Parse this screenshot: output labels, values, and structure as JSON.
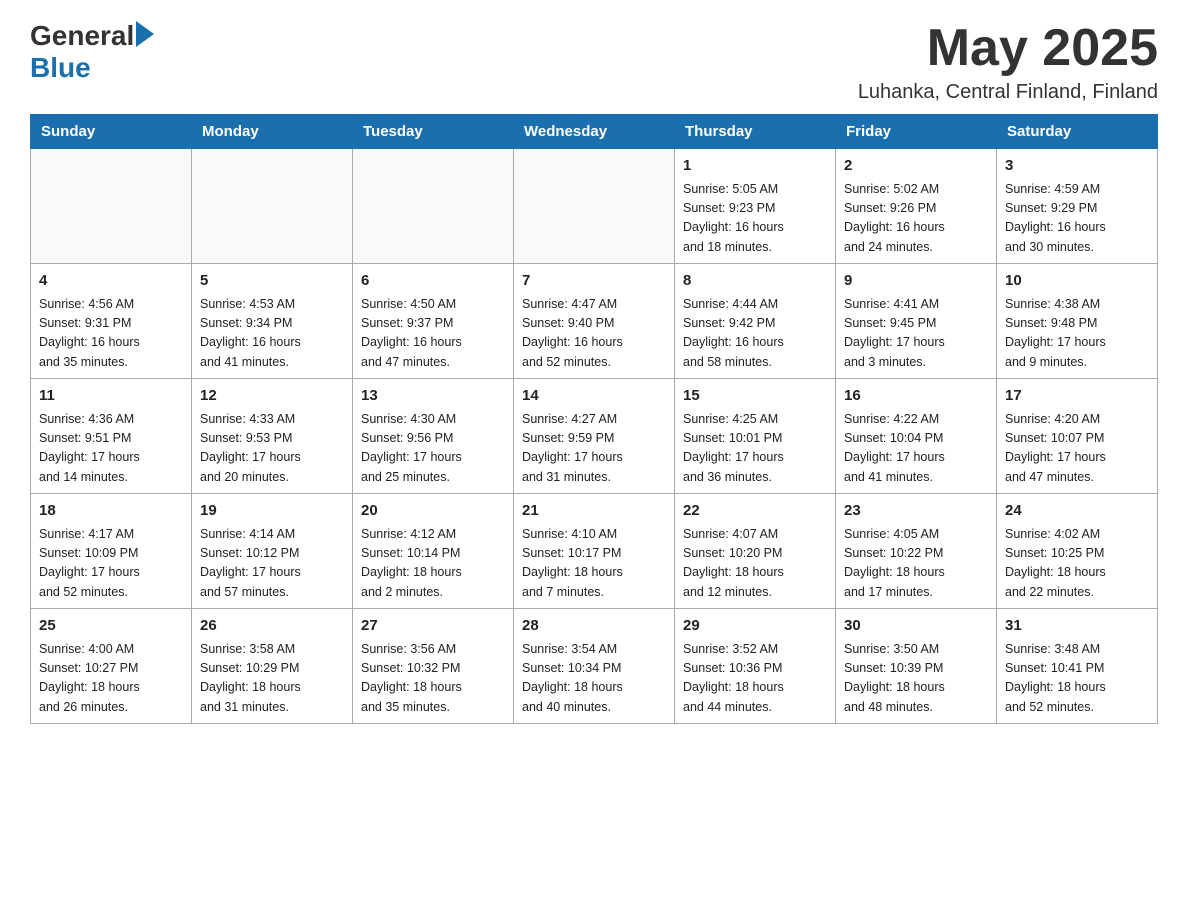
{
  "header": {
    "logo_general": "General",
    "logo_blue": "Blue",
    "month_title": "May 2025",
    "location": "Luhanka, Central Finland, Finland"
  },
  "days_of_week": [
    "Sunday",
    "Monday",
    "Tuesday",
    "Wednesday",
    "Thursday",
    "Friday",
    "Saturday"
  ],
  "weeks": [
    [
      {
        "day": "",
        "info": ""
      },
      {
        "day": "",
        "info": ""
      },
      {
        "day": "",
        "info": ""
      },
      {
        "day": "",
        "info": ""
      },
      {
        "day": "1",
        "info": "Sunrise: 5:05 AM\nSunset: 9:23 PM\nDaylight: 16 hours\nand 18 minutes."
      },
      {
        "day": "2",
        "info": "Sunrise: 5:02 AM\nSunset: 9:26 PM\nDaylight: 16 hours\nand 24 minutes."
      },
      {
        "day": "3",
        "info": "Sunrise: 4:59 AM\nSunset: 9:29 PM\nDaylight: 16 hours\nand 30 minutes."
      }
    ],
    [
      {
        "day": "4",
        "info": "Sunrise: 4:56 AM\nSunset: 9:31 PM\nDaylight: 16 hours\nand 35 minutes."
      },
      {
        "day": "5",
        "info": "Sunrise: 4:53 AM\nSunset: 9:34 PM\nDaylight: 16 hours\nand 41 minutes."
      },
      {
        "day": "6",
        "info": "Sunrise: 4:50 AM\nSunset: 9:37 PM\nDaylight: 16 hours\nand 47 minutes."
      },
      {
        "day": "7",
        "info": "Sunrise: 4:47 AM\nSunset: 9:40 PM\nDaylight: 16 hours\nand 52 minutes."
      },
      {
        "day": "8",
        "info": "Sunrise: 4:44 AM\nSunset: 9:42 PM\nDaylight: 16 hours\nand 58 minutes."
      },
      {
        "day": "9",
        "info": "Sunrise: 4:41 AM\nSunset: 9:45 PM\nDaylight: 17 hours\nand 3 minutes."
      },
      {
        "day": "10",
        "info": "Sunrise: 4:38 AM\nSunset: 9:48 PM\nDaylight: 17 hours\nand 9 minutes."
      }
    ],
    [
      {
        "day": "11",
        "info": "Sunrise: 4:36 AM\nSunset: 9:51 PM\nDaylight: 17 hours\nand 14 minutes."
      },
      {
        "day": "12",
        "info": "Sunrise: 4:33 AM\nSunset: 9:53 PM\nDaylight: 17 hours\nand 20 minutes."
      },
      {
        "day": "13",
        "info": "Sunrise: 4:30 AM\nSunset: 9:56 PM\nDaylight: 17 hours\nand 25 minutes."
      },
      {
        "day": "14",
        "info": "Sunrise: 4:27 AM\nSunset: 9:59 PM\nDaylight: 17 hours\nand 31 minutes."
      },
      {
        "day": "15",
        "info": "Sunrise: 4:25 AM\nSunset: 10:01 PM\nDaylight: 17 hours\nand 36 minutes."
      },
      {
        "day": "16",
        "info": "Sunrise: 4:22 AM\nSunset: 10:04 PM\nDaylight: 17 hours\nand 41 minutes."
      },
      {
        "day": "17",
        "info": "Sunrise: 4:20 AM\nSunset: 10:07 PM\nDaylight: 17 hours\nand 47 minutes."
      }
    ],
    [
      {
        "day": "18",
        "info": "Sunrise: 4:17 AM\nSunset: 10:09 PM\nDaylight: 17 hours\nand 52 minutes."
      },
      {
        "day": "19",
        "info": "Sunrise: 4:14 AM\nSunset: 10:12 PM\nDaylight: 17 hours\nand 57 minutes."
      },
      {
        "day": "20",
        "info": "Sunrise: 4:12 AM\nSunset: 10:14 PM\nDaylight: 18 hours\nand 2 minutes."
      },
      {
        "day": "21",
        "info": "Sunrise: 4:10 AM\nSunset: 10:17 PM\nDaylight: 18 hours\nand 7 minutes."
      },
      {
        "day": "22",
        "info": "Sunrise: 4:07 AM\nSunset: 10:20 PM\nDaylight: 18 hours\nand 12 minutes."
      },
      {
        "day": "23",
        "info": "Sunrise: 4:05 AM\nSunset: 10:22 PM\nDaylight: 18 hours\nand 17 minutes."
      },
      {
        "day": "24",
        "info": "Sunrise: 4:02 AM\nSunset: 10:25 PM\nDaylight: 18 hours\nand 22 minutes."
      }
    ],
    [
      {
        "day": "25",
        "info": "Sunrise: 4:00 AM\nSunset: 10:27 PM\nDaylight: 18 hours\nand 26 minutes."
      },
      {
        "day": "26",
        "info": "Sunrise: 3:58 AM\nSunset: 10:29 PM\nDaylight: 18 hours\nand 31 minutes."
      },
      {
        "day": "27",
        "info": "Sunrise: 3:56 AM\nSunset: 10:32 PM\nDaylight: 18 hours\nand 35 minutes."
      },
      {
        "day": "28",
        "info": "Sunrise: 3:54 AM\nSunset: 10:34 PM\nDaylight: 18 hours\nand 40 minutes."
      },
      {
        "day": "29",
        "info": "Sunrise: 3:52 AM\nSunset: 10:36 PM\nDaylight: 18 hours\nand 44 minutes."
      },
      {
        "day": "30",
        "info": "Sunrise: 3:50 AM\nSunset: 10:39 PM\nDaylight: 18 hours\nand 48 minutes."
      },
      {
        "day": "31",
        "info": "Sunrise: 3:48 AM\nSunset: 10:41 PM\nDaylight: 18 hours\nand 52 minutes."
      }
    ]
  ]
}
